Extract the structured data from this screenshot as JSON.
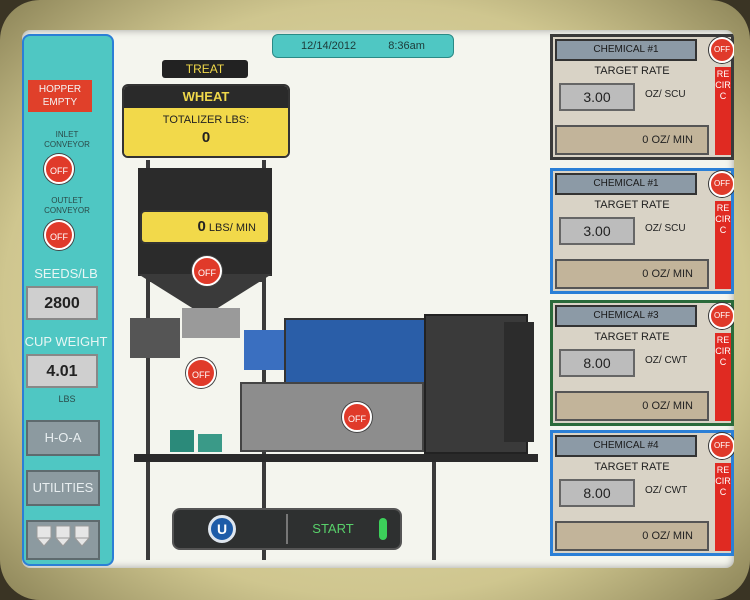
{
  "date": "12/14/2012",
  "time": "8:36am",
  "left": {
    "hopper_status": "HOPPER EMPTY",
    "inlet_label": "INLET CONVEYOR",
    "inlet_state": "OFF",
    "outlet_label": "OUTLET CONVEYOR",
    "outlet_state": "OFF",
    "seeds_label": "SEEDS/LB",
    "seeds_value": "2800",
    "cup_label": "CUP WEIGHT",
    "cup_value": "4.01",
    "cup_unit": "LBS",
    "hoa_label": "H-O-A",
    "utilities_label": "UTILITIES"
  },
  "machine": {
    "treat_label": "TREAT",
    "crop": "WHEAT",
    "totalizer_label": "TOTALIZER LBS:",
    "totalizer_value": "0",
    "flow_value": "0",
    "flow_unit": "LBS/ MIN",
    "hopper_gate_state": "OFF",
    "auger_state": "OFF",
    "drum_state": "OFF",
    "start_label": "START",
    "logo_letter": "U"
  },
  "chemicals": [
    {
      "name": "CHEMICAL #1",
      "state": "OFF",
      "target_label": "TARGET RATE",
      "rate": "3.00",
      "rate_unit": "OZ/ SCU",
      "flow": "0 OZ/ MIN",
      "recirc": "RECIRC"
    },
    {
      "name": "CHEMICAL #1",
      "state": "OFF",
      "target_label": "TARGET RATE",
      "rate": "3.00",
      "rate_unit": "OZ/ SCU",
      "flow": "0 OZ/ MIN",
      "recirc": "RECIRC"
    },
    {
      "name": "CHEMICAL #3",
      "state": "OFF",
      "target_label": "TARGET RATE",
      "rate": "8.00",
      "rate_unit": "OZ/ CWT",
      "flow": "0 OZ/ MIN",
      "recirc": "RECIRC"
    },
    {
      "name": "CHEMICAL #4",
      "state": "OFF",
      "target_label": "TARGET RATE",
      "rate": "8.00",
      "rate_unit": "OZ/ CWT",
      "flow": "0 OZ/ MIN",
      "recirc": "RECIRC"
    }
  ],
  "colors": {
    "panel_cyan": "#4fc7c3",
    "off_red": "#e03a2a",
    "display_yellow": "#f2d94a",
    "start_green": "#3cd05a"
  }
}
